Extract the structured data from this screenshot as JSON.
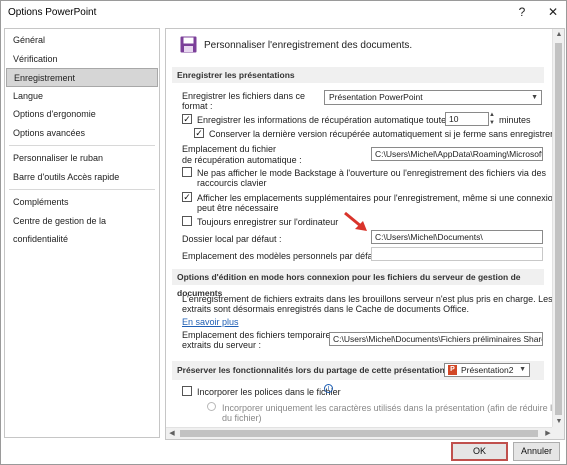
{
  "window": {
    "title": "Options PowerPoint",
    "help": "?",
    "close": "✕"
  },
  "sidebar": {
    "items": [
      "Général",
      "Vérification",
      "Enregistrement",
      "Langue",
      "Options d'ergonomie",
      "Options avancées",
      "Personnaliser le ruban",
      "Barre d'outils Accès rapide",
      "Compléments",
      "Centre de gestion de la confidentialité"
    ],
    "active": "Enregistrement"
  },
  "header": {
    "text": "Personnaliser l'enregistrement des documents."
  },
  "save_section": {
    "title": "Enregistrer les présentations",
    "format_label_1": "Enregistrer les fichiers dans ce",
    "format_label_2": "format :",
    "format_value": "Présentation PowerPoint",
    "autorecover_label": "Enregistrer les informations de récupération automatique toutes les",
    "autorecover_minutes": "10",
    "minutes_label": "minutes",
    "keep_last_label": "Conserver la dernière version récupérée automatiquement si je ferme sans enregistrer",
    "autorecover_location_1": "Emplacement du fichier",
    "autorecover_location_2": "de récupération automatique :",
    "autorecover_path": "C:\\Users\\Michel\\AppData\\Roaming\\Microsoft\\",
    "backstage_label_1": "Ne pas afficher le mode Backstage à l'ouverture ou l'enregistrement des fichiers via des",
    "backstage_label_2": "raccourcis clavier",
    "show_locations_1": "Afficher les emplacements supplémentaires pour l'enregistrement, même si une connexion",
    "show_locations_2": "peut être nécessaire",
    "always_computer": "Toujours enregistrer sur l'ordinateur",
    "local_folder_label": "Dossier local par défaut :",
    "local_folder_value": "C:\\Users\\Michel\\Documents\\",
    "templates_label": "Emplacement des modèles personnels par défaut :",
    "templates_value": ""
  },
  "offline_section": {
    "title": "Options d'édition en mode hors connexion pour les fichiers du serveur de gestion de documents",
    "info_1": "L'enregistrement de fichiers extraits dans les brouillons serveur n'est plus pris en charge. Les fichiers",
    "info_2": "extraits sont désormais enregistrés dans le Cache de documents Office.",
    "learn_more": "En savoir plus",
    "temp_label_1": "Emplacement des fichiers temporaires",
    "temp_label_2": "extraits du serveur :",
    "temp_value": "C:\\Users\\Michel\\Documents\\Fichiers préliminaires SharePo"
  },
  "share_section": {
    "title": "Préserver les fonctionnalités lors du partage de cette présentation :",
    "presentation": "Présentation2",
    "embed_fonts": "Incorporer les polices dans le fichier",
    "embed_used_1": "Incorporer uniquement les caractères utilisés dans la présentation (afin de réduire la taille",
    "embed_used_2": "du fichier)"
  },
  "buttons": {
    "ok": "OK",
    "cancel": "Annuler"
  },
  "colors": {
    "accent_red": "#c0504d",
    "save_icon_purple": "#7b3f99",
    "link_blue": "#1f5fb4"
  }
}
